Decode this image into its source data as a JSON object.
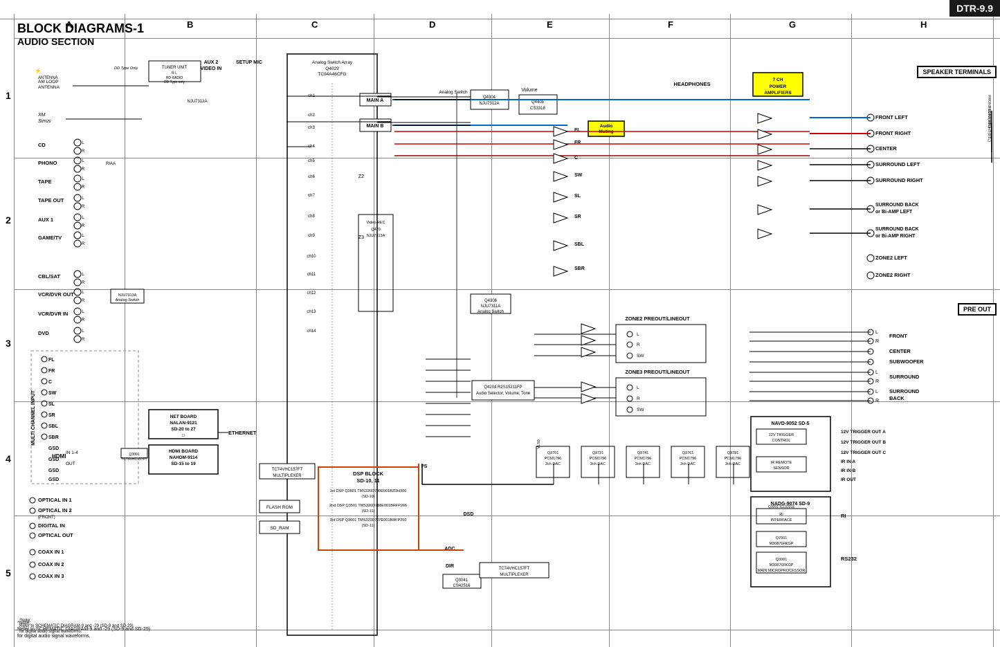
{
  "title_badge": "DTR-9.9",
  "main_title_line1": "BLOCK DIAGRAMS-1",
  "main_title_line2": "AUDIO SECTION",
  "columns": [
    "A",
    "B",
    "C",
    "D",
    "E",
    "F",
    "G",
    "H"
  ],
  "col_positions": [
    30,
    185,
    375,
    545,
    715,
    885,
    1060,
    1230,
    1415
  ],
  "rows": [
    "1",
    "2",
    "3",
    "4",
    "5"
  ],
  "row_positions": [
    55,
    230,
    415,
    575,
    740,
    900
  ],
  "speaker_terminals": "SPEAKER TERMINALS",
  "pre_out": "PRE OUT",
  "center_label": "CENTER",
  "speaker_outputs": [
    "FRONT LEFT",
    "FRONT RIGHT",
    "CENTER",
    "SURROUND LEFT",
    "SURROUND RIGHT",
    "SURROUND BACK or Bi-AMP LEFT",
    "SURROUND BACK or Bi-AMP RIGHT",
    "ZONE2 LEFT",
    "ZONE2 RIGHT"
  ],
  "pre_out_outputs": [
    "FRONT",
    "CENTER",
    "SUBWOOFER",
    "SURROUND",
    "SURROUND BACK"
  ],
  "input_labels": [
    "AM LOOP ANTENNA",
    "XM Sirrus",
    "CD",
    "PHONO",
    "TAPE",
    "TAPE OUT",
    "AUX 1",
    "GAME/TV",
    "CBL/SAT",
    "VCR/DVR OUT",
    "VCR/DVR IN",
    "DVD",
    "OPTICAL IN 1",
    "OPTICAL IN 2 (FRONT)",
    "DIGITAL IN",
    "OPTICAL OUT",
    "COAX IN 1",
    "COAX IN 2",
    "COAX IN 3"
  ],
  "components": {
    "tuner_unit": "TUNER UNIT",
    "aux2_video_in": "AUX 2 VIDEO IN",
    "setup_mic": "SETUP MIC",
    "analog_switch_array": "Analog Switch Array Q4029 TC94A46CFG",
    "main_a": "MAIN A",
    "main_b": "MAIN B",
    "q4304": "Q4304 NJU7312A",
    "q4405": "Q4405 CS3318",
    "audio_muting": "Audio Muting",
    "headphones": "HEADPHONES",
    "7ch_power": "7 CH POWER AMPLIFIERS",
    "net_board": "NET BOARD NALAN-9121 SD-20 to 27",
    "hdmi_board": "HDMI BOARD NAHDM-9114 SD-15 to 19",
    "ethernet": "ETHERNET",
    "hdmi_in": "IN 1-4",
    "hdmi_out": "OUT",
    "tc74vhc157ft_mux": "TC74VHC157FT MULTIPLEXER",
    "flash_rom": "FLASH ROM",
    "sd_ram": "SD_RAM",
    "dsp_block": "DSP BLOCK SD-10, 11",
    "dsp1": "1st DSP Q3501 TMS320D790E001BZDH300 (SD-10)",
    "dsp2": "2nd DSP Q3501 TMS320D788E001BRFP266 (SD-11)",
    "dsp3": "3rd DSP Q3601 TMS320D707E001BRFP250 (SD-11)",
    "q4306": "Q4306 NJU7311A Analog Switch",
    "q4204": "Q4204 R2S15211FP Audio Selector, Volume, Tone",
    "zone2_preout": "ZONE2 PREOUT/LINEOUT",
    "zone3_preout": "ZONE3 PREOUT/LINEOUT",
    "navd_9052": "NAVD-9052 SD-5",
    "nadg_9074": "NADG-9074 SD-9",
    "12v_trig_a": "12V TRIGGER OUT A",
    "12v_trig_b": "12V TRIGGER OUT B",
    "12v_trig_c": "12V TRIGGER OUT C",
    "ir_in_a": "IR IN A",
    "ir_in_b": "IR IN B",
    "ir_out": "IR OUT",
    "ri": "RI",
    "rs232": "RS232",
    "tc74vhc157ft_mux2": "TC74VHC157FT MULTIPLEXER",
    "q3701": "Q3701 PCM1796 2ch DAC",
    "q3721": "Q3721 PCM1796 2ch DAC",
    "q3741": "Q3741 PCM1796 2ch DAC",
    "q3761": "Q3761 PCM1796 2ch DAC",
    "q3781": "Q3781 PCM1796 2ch DAC",
    "q3041": "Q3041 CS42516",
    "adc": "ADC",
    "dir": "DIR",
    "dsd": "DSD",
    "i2s": "I2S",
    "nju7313a": "NJU7313A",
    "hd_radio": "HD RADIO DD Type only",
    "q3001_mux": "Q3001 TC74VHC157FT",
    "q3001_rs232": "Q3001 ICL3221E RS232 INTERFACE",
    "q7001": "Q7001 M30876FKGP MAIN MICROPROCESSOR",
    "12v_trig_ctrl": "12V TRIGGER CONTROL",
    "ir_remote": "IR REMOTE SENSOR",
    "ri_interface": "RI INTERFACE"
  },
  "note_text": "*Note:\nRefer to SCHEMATIC DIAGRAM-9 and -29 (SD-9 and SD-29)\nfor digital audio signal waveforms.",
  "multi_channel_input": "MULTI CHANNEL INPUT",
  "front_left_btl": "FRONT LEFT(BTL)",
  "front_right_btl": "FRONT RIGHT(BTL)"
}
